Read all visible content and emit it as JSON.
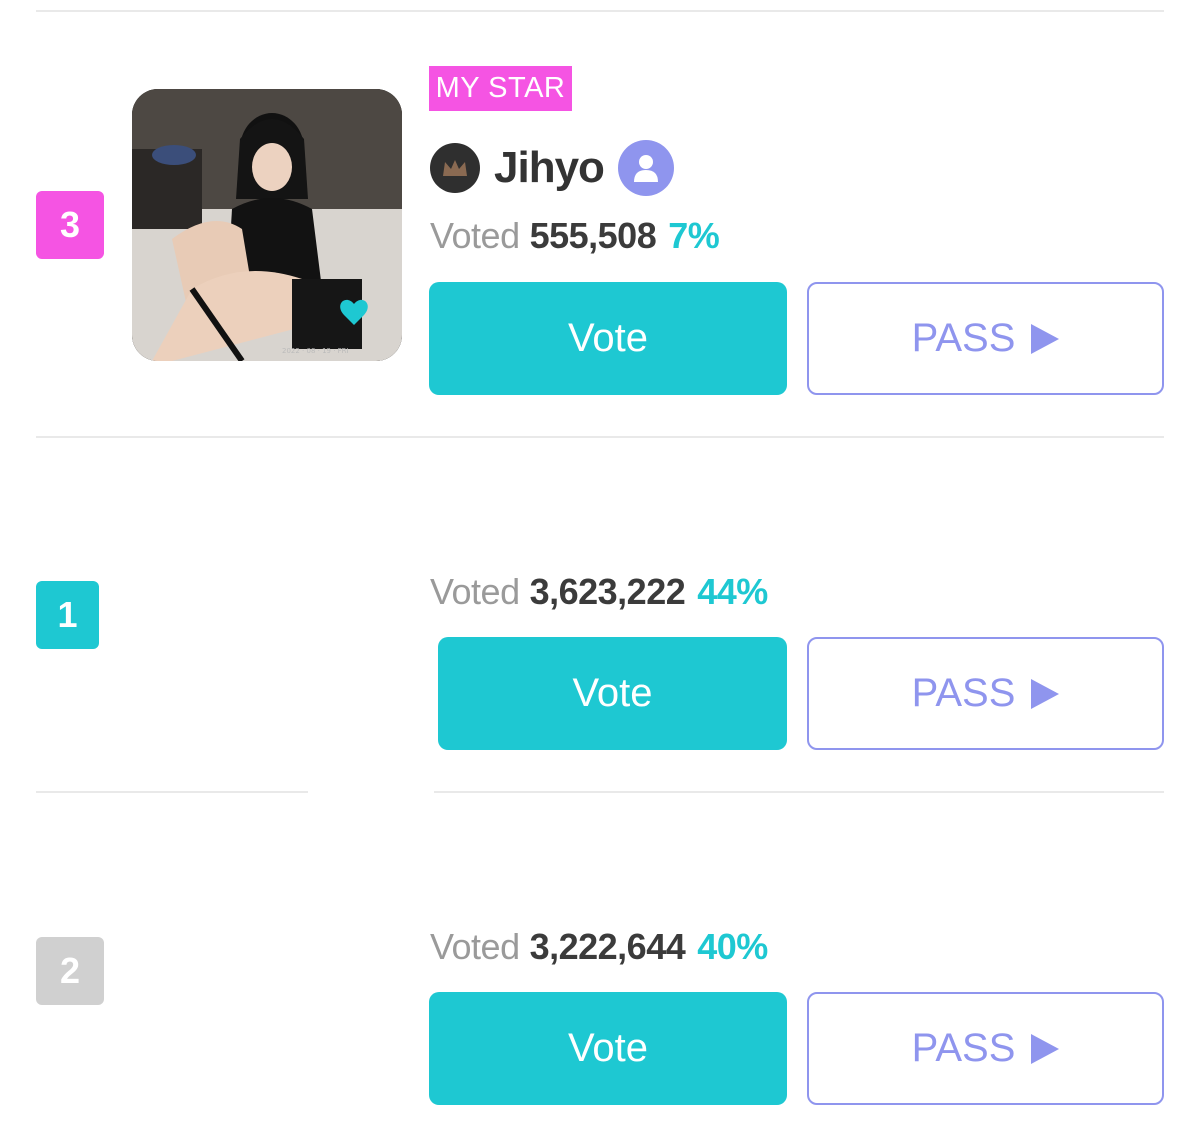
{
  "colors": {
    "teal": "#1ec8d2",
    "pink": "#f554e3",
    "grey_badge": "#d0d0d0",
    "pass": "#8f95ee",
    "percent": "#1ec8d2"
  },
  "rows": [
    {
      "rank": "3",
      "rank_color": "#f554e3",
      "tag": "MY STAR",
      "name": "Jihyo",
      "icons": [
        "crown-icon",
        "profile-icon",
        "heart-icon"
      ],
      "voted_label": "Voted",
      "votes": "555,508",
      "percent": "7%",
      "vote_label": "Vote",
      "pass_label": "PASS"
    },
    {
      "rank": "1",
      "rank_color": "#1ec8d2",
      "voted_label": "Voted",
      "votes": "3,623,222",
      "percent": "44%",
      "vote_label": "Vote",
      "pass_label": "PASS"
    },
    {
      "rank": "2",
      "rank_color": "#d0d0d0",
      "voted_label": "Voted",
      "votes": "3,222,644",
      "percent": "40%",
      "vote_label": "Vote",
      "pass_label": "PASS"
    }
  ]
}
